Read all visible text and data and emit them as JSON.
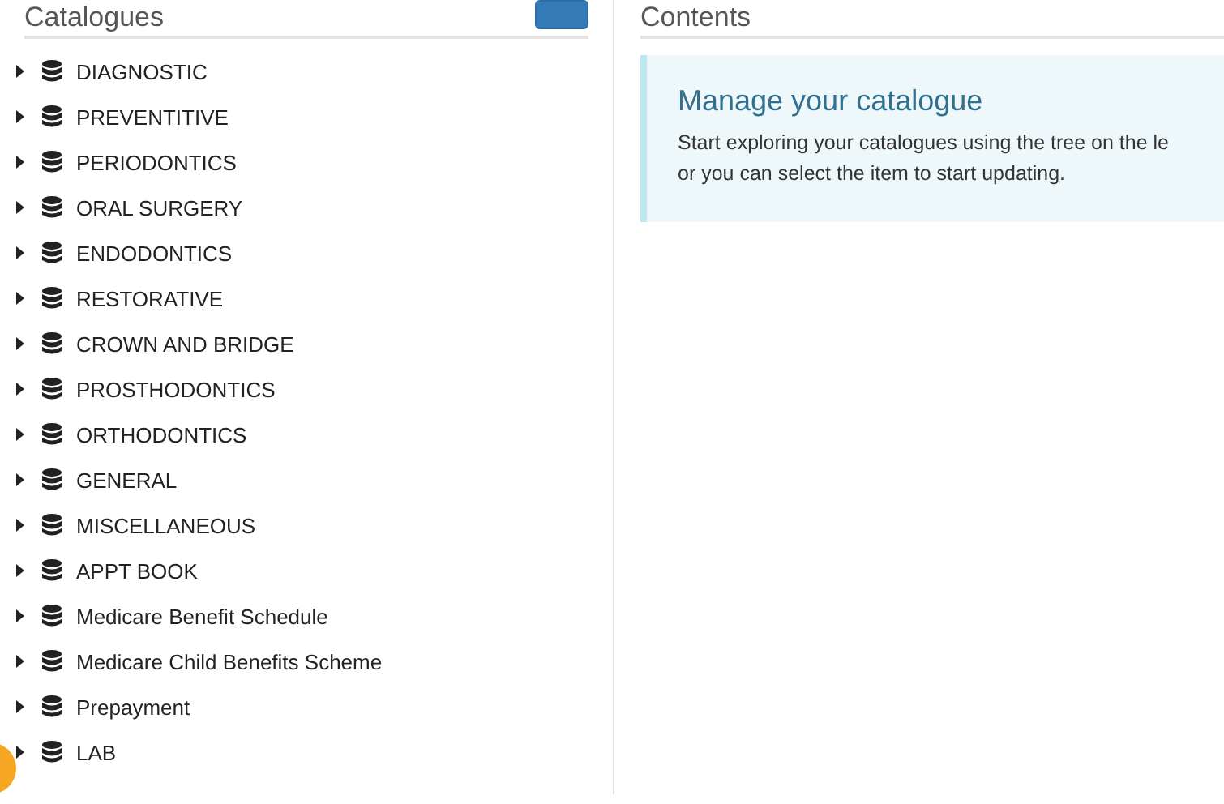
{
  "catalogues": {
    "title": "Catalogues",
    "items": [
      {
        "label": "DIAGNOSTIC",
        "expanded": false
      },
      {
        "label": "PREVENTITIVE",
        "expanded": false
      },
      {
        "label": "PERIODONTICS",
        "expanded": false
      },
      {
        "label": "ORAL SURGERY",
        "expanded": false
      },
      {
        "label": "ENDODONTICS",
        "expanded": false
      },
      {
        "label": "RESTORATIVE",
        "expanded": false
      },
      {
        "label": "CROWN AND BRIDGE",
        "expanded": false
      },
      {
        "label": "PROSTHODONTICS",
        "expanded": false
      },
      {
        "label": "ORTHODONTICS",
        "expanded": false
      },
      {
        "label": "GENERAL",
        "expanded": false
      },
      {
        "label": "MISCELLANEOUS",
        "expanded": false
      },
      {
        "label": "APPT BOOK",
        "expanded": false
      },
      {
        "label": "Medicare Benefit Schedule",
        "expanded": false
      },
      {
        "label": "Medicare Child Benefits Scheme",
        "expanded": false
      },
      {
        "label": "Prepayment",
        "expanded": false
      },
      {
        "label": "LAB",
        "expanded": false
      }
    ]
  },
  "contents": {
    "title": "Contents",
    "callout": {
      "title": "Manage your catalogue",
      "lines": [
        "Start exploring your catalogues using the tree on the le",
        "or you can select the item to start updating."
      ]
    }
  }
}
